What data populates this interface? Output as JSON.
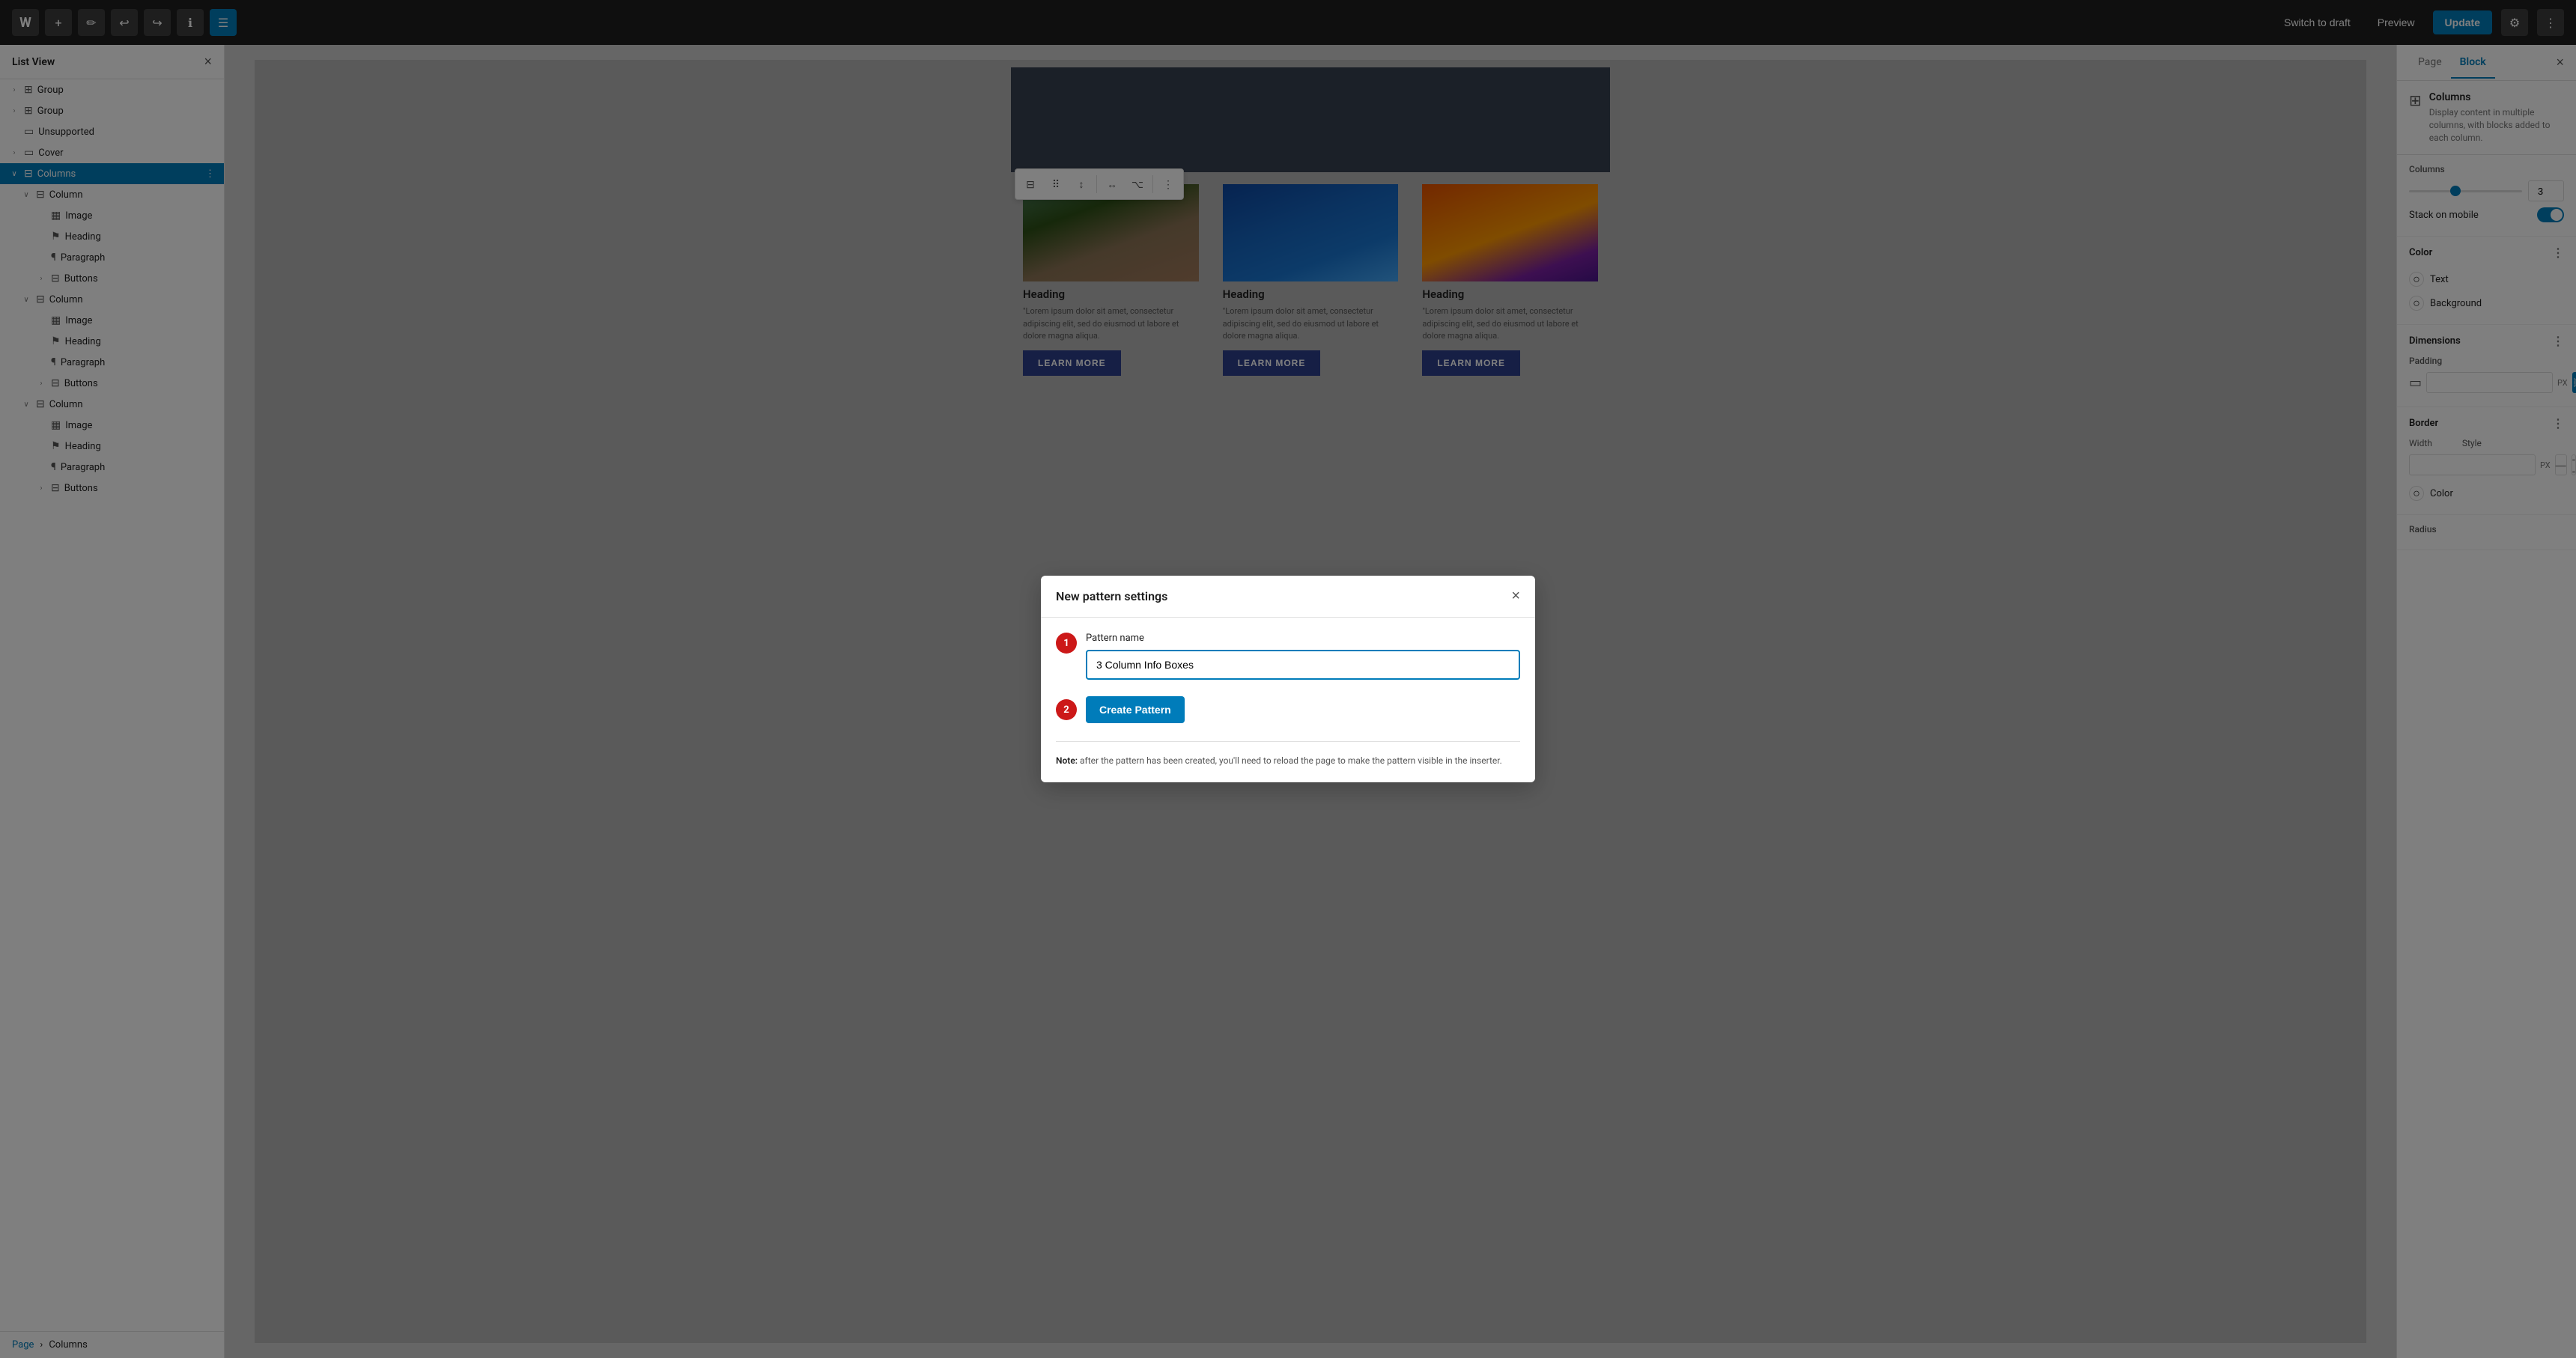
{
  "topbar": {
    "logo": "W",
    "add_label": "+",
    "edit_label": "✏",
    "undo_label": "↩",
    "redo_label": "↪",
    "info_label": "ℹ",
    "list_view_label": "☰",
    "switch_draft": "Switch to draft",
    "preview": "Preview",
    "update": "Update",
    "settings_icon": "⚙",
    "options_icon": "⋮"
  },
  "sidebar": {
    "title": "List View",
    "close_icon": "×",
    "items": [
      {
        "id": "group1",
        "label": "Group",
        "icon": "⊞",
        "indent": 0,
        "chevron": "›"
      },
      {
        "id": "group2",
        "label": "Group",
        "icon": "⊞",
        "indent": 0,
        "chevron": "›"
      },
      {
        "id": "unsupported",
        "label": "Unsupported",
        "icon": "▭",
        "indent": 0,
        "chevron": ""
      },
      {
        "id": "cover",
        "label": "Cover",
        "icon": "▭",
        "indent": 0,
        "chevron": "›"
      },
      {
        "id": "columns",
        "label": "Columns",
        "icon": "⊟",
        "indent": 0,
        "chevron": "∨",
        "active": true
      },
      {
        "id": "column1",
        "label": "Column",
        "icon": "⊟",
        "indent": 1,
        "chevron": "∨"
      },
      {
        "id": "image1",
        "label": "Image",
        "icon": "▦",
        "indent": 2,
        "chevron": ""
      },
      {
        "id": "heading1",
        "label": "Heading",
        "icon": "⚑",
        "indent": 2,
        "chevron": ""
      },
      {
        "id": "paragraph1",
        "label": "Paragraph",
        "icon": "¶",
        "indent": 2,
        "chevron": ""
      },
      {
        "id": "buttons1",
        "label": "Buttons",
        "icon": "⊟",
        "indent": 2,
        "chevron": "›"
      },
      {
        "id": "column2",
        "label": "Column",
        "icon": "⊟",
        "indent": 1,
        "chevron": "∨"
      },
      {
        "id": "image2",
        "label": "Image",
        "icon": "▦",
        "indent": 2,
        "chevron": ""
      },
      {
        "id": "heading2",
        "label": "Heading",
        "icon": "⚑",
        "indent": 2,
        "chevron": ""
      },
      {
        "id": "paragraph2",
        "label": "Paragraph",
        "icon": "¶",
        "indent": 2,
        "chevron": ""
      },
      {
        "id": "buttons2",
        "label": "Buttons",
        "icon": "⊟",
        "indent": 2,
        "chevron": "›"
      },
      {
        "id": "column3",
        "label": "Column",
        "icon": "⊟",
        "indent": 1,
        "chevron": "∨"
      },
      {
        "id": "image3",
        "label": "Image",
        "icon": "▦",
        "indent": 2,
        "chevron": ""
      },
      {
        "id": "heading3",
        "label": "Heading",
        "icon": "⚑",
        "indent": 2,
        "chevron": ""
      },
      {
        "id": "paragraph3",
        "label": "Paragraph",
        "icon": "¶",
        "indent": 2,
        "chevron": ""
      },
      {
        "id": "buttons3",
        "label": "Buttons",
        "icon": "⊟",
        "indent": 2,
        "chevron": "›"
      }
    ],
    "breadcrumb_page": "Page",
    "breadcrumb_sep": "›",
    "breadcrumb_current": "Columns"
  },
  "toolbar": {
    "columns_icon": "⊟",
    "drag_icon": "⠿",
    "move_icon": "↕",
    "align_icon": "↔",
    "transform_icon": "⌥",
    "more_icon": "⋮"
  },
  "columns_section": {
    "columns": [
      {
        "heading": "Heading",
        "paragraph": "\"Lorem ipsum dolor sit amet, consectetur adipiscing elit, sed do eiusmod ut labore et dolore magna aliqua.",
        "button": "LEARN MORE"
      },
      {
        "heading": "Heading",
        "paragraph": "\"Lorem ipsum dolor sit amet, consectetur adipiscing elit, sed do eiusmod ut labore et dolore magna aliqua.",
        "button": "LEARN MORE"
      },
      {
        "heading": "Heading",
        "paragraph": "\"Lorem ipsum dolor sit amet, consectetur adipiscing elit, sed do eiusmod ut labore et dolore magna aliqua.",
        "button": "LEARN MORE"
      }
    ]
  },
  "right_panel": {
    "tab_page": "Page",
    "tab_block": "Block",
    "close_icon": "×",
    "block_icon": "⊞",
    "block_title": "Columns",
    "block_desc": "Display content in multiple columns, with blocks added to each column.",
    "columns_label": "Columns",
    "columns_value": "3",
    "stack_on_mobile": "Stack on mobile",
    "color_section": "Color",
    "color_opts_icon": "⋮",
    "text_label": "Text",
    "background_label": "Background",
    "dimensions_section": "Dimensions",
    "dimensions_opts_icon": "⋮",
    "padding_label": "Padding",
    "padding_value": "",
    "padding_unit": "PX",
    "border_section": "Border",
    "border_opts_icon": "⋮",
    "border_width_label": "Width",
    "border_style_label": "Style",
    "border_width_value": "",
    "border_unit": "PX",
    "border_color_label": "Color",
    "radius_label": "Radius"
  },
  "modal": {
    "title": "New pattern settings",
    "close_icon": "×",
    "field_label": "Pattern name",
    "input_value": "3 Column Info Boxes",
    "create_button": "Create Pattern",
    "step1": "1",
    "step2": "2",
    "note": "Note: after the pattern has been created, you'll need to reload the page to make the pattern visible in the inserter."
  }
}
